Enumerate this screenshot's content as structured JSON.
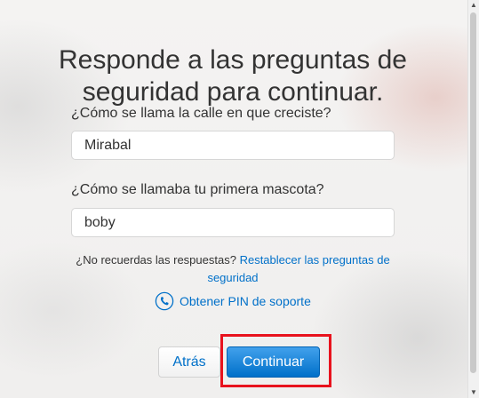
{
  "page": {
    "title": "Responde a las preguntas de seguridad para continuar."
  },
  "questions": [
    {
      "label": "¿Cómo se llama la calle en que creciste?",
      "answer": "Mirabal"
    },
    {
      "label": "¿Cómo se llamaba tu primera mascota?",
      "answer": "boby"
    }
  ],
  "forgot": {
    "text": "¿No recuerdas las respuestas?",
    "link": "Restablecer las preguntas de seguridad"
  },
  "support_pin": {
    "label": "Obtener PIN de soporte",
    "icon": "phone-icon"
  },
  "actions": {
    "back_label": "Atrás",
    "continue_label": "Continuar"
  },
  "colors": {
    "link": "#0070c9",
    "primary_button": "#0070c9",
    "highlight": "#e8121d"
  }
}
